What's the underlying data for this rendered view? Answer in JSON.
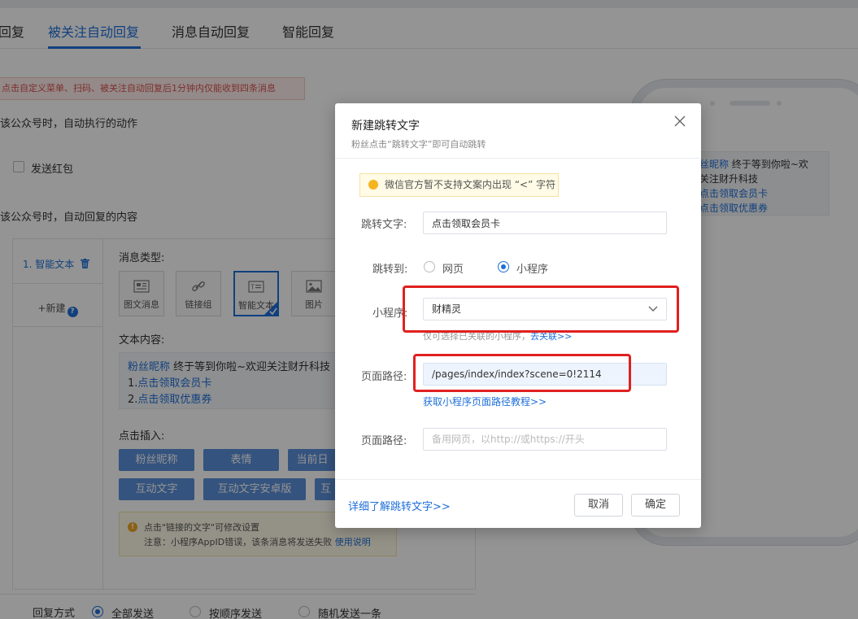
{
  "tabs": [
    {
      "label": "回复"
    },
    {
      "label": "被关注自动回复"
    },
    {
      "label": "消息自动回复"
    },
    {
      "label": "智能回复"
    }
  ],
  "notice": "点击自定义菜单、扫码、被关注自动回复后1分钟内仅能收到四条消息",
  "section_action": "该公众号时，自动执行的动作",
  "checkbox_label": "发送红包",
  "section_reply": "该公众号时，自动回复的内容",
  "editor": {
    "item_1": "1. 智能文本",
    "new_label": "+新建",
    "help_badge": "?",
    "msg_type_label": "消息类型:",
    "types": [
      {
        "label": "图文消息"
      },
      {
        "label": "链接组"
      },
      {
        "label": "智能文本"
      },
      {
        "label": "图片"
      }
    ],
    "content_label": "文本内容:",
    "content_nick": "粉丝昵称",
    "content_line1": " 终于等到你啦~欢迎关注财升科技",
    "content_line2_prefix": "1.",
    "content_line2_link": "点击领取会员卡",
    "content_line3_prefix": "2.",
    "content_line3_link": "点击领取优惠券",
    "insert_label": "点击插入:",
    "insert_buttons": [
      {
        "label": "粉丝昵称"
      },
      {
        "label": "表情"
      },
      {
        "label": "当前日"
      },
      {
        "label": "互动文字"
      },
      {
        "label": "互动文字安卓版"
      },
      {
        "label": "互"
      }
    ],
    "tip_icon": "!",
    "tip_line1": "点击\"链接的文字\"可修改设置",
    "tip_line2": "注意：小程序AppID错误，该条消息将发送失败",
    "tip_link": "使用说明"
  },
  "reply_row": {
    "label": "回复方式",
    "options": [
      {
        "label": "全部发送",
        "selected": true
      },
      {
        "label": "按顺序发送",
        "selected": false
      },
      {
        "label": "随机发送一条",
        "selected": false
      }
    ]
  },
  "preview": {
    "nick": "丝昵称",
    "line1": " 终于等到你啦~欢",
    "line2": "关注财升科技",
    "link1": "点击领取会员卡",
    "link2": "点击领取优惠券"
  },
  "modal": {
    "title": "新建跳转文字",
    "subtitle": "粉丝点击“跳转文字”即可自动跳转",
    "warning": "微信官方暂不支持文案内出现 “<” 字符",
    "jump_text_label": "跳转文字:",
    "jump_text_value": "点击领取会员卡",
    "jump_to_label": "跳转到:",
    "jump_options": [
      {
        "label": "网页",
        "selected": false
      },
      {
        "label": "小程序",
        "selected": true
      }
    ],
    "miniprogram_label": "小程序:",
    "miniprogram_value": "财精灵",
    "miniprogram_hint": "仅可选择已关联的小程序，",
    "miniprogram_hint_link": "去关联>>",
    "page_path_label": "页面路径:",
    "page_path_value": "/pages/index/index?scene=0!2114",
    "page_path_link": "获取小程序页面路径教程>>",
    "backup_path_label": "页面路径:",
    "backup_path_placeholder": "备用网页，以http://或https://开头",
    "learn_more": "详细了解跳转文字>>",
    "cancel": "取消",
    "confirm": "确定"
  },
  "colors": {
    "accent": "#1e6fd9",
    "highlight_box": "#e02020",
    "warning": "#f5b51f"
  }
}
